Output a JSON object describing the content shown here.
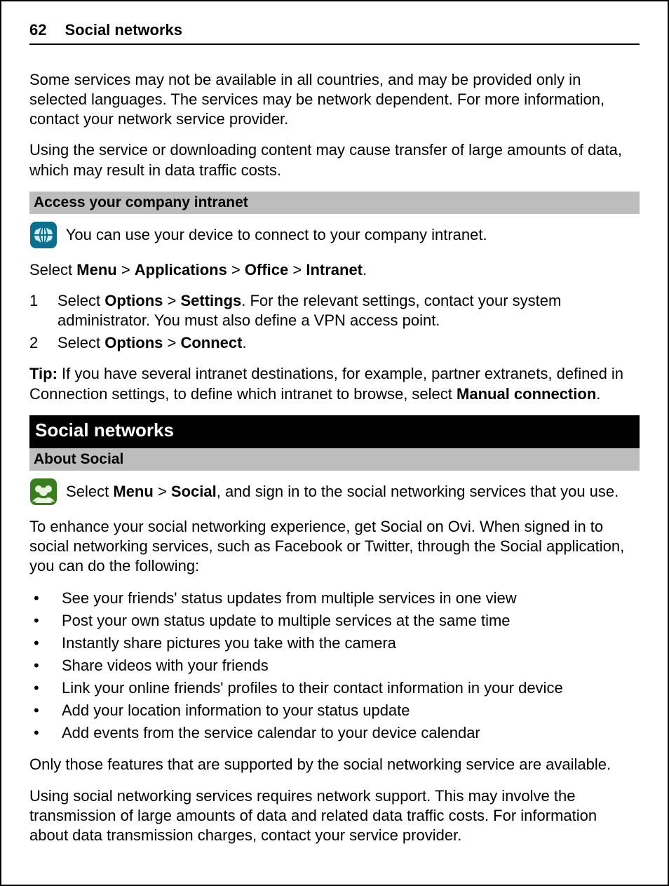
{
  "header": {
    "page_number": "62",
    "title": "Social networks"
  },
  "intro": {
    "p1": "Some services may not be available in all countries, and may be provided only in selected languages. The services may be network dependent. For more information, contact your network service provider.",
    "p2": "Using the service or downloading content may cause transfer of large amounts of data, which may result in data traffic costs."
  },
  "section1": {
    "title": "Access your company intranet",
    "icon_text": " You can use your device to connect to your company intranet.",
    "select_line": {
      "pre": "Select ",
      "b1": "Menu",
      "s1": " > ",
      "b2": "Applications",
      "s2": " > ",
      "b3": "Office",
      "s3": " > ",
      "b4": "Intranet",
      "post": "."
    },
    "steps": [
      {
        "pre": "Select ",
        "b1": "Options",
        "s1": " > ",
        "b2": "Settings",
        "post": ". For the relevant settings, contact your system administrator. You must also define a VPN access point."
      },
      {
        "pre": "Select ",
        "b1": "Options",
        "s1": " > ",
        "b2": "Connect",
        "post": "."
      }
    ],
    "tip": {
      "label": "Tip: ",
      "body_pre": "If you have several intranet destinations, for example, partner extranets, defined in Connection settings, to define which intranet to browse, select ",
      "bold": "Manual connection",
      "post": "."
    }
  },
  "chapter": {
    "title": "Social networks"
  },
  "section2": {
    "title": "About Social",
    "icon_line": {
      "pre": " Select ",
      "b1": "Menu",
      "s1": " > ",
      "b2": "Social",
      "post": ", and sign in to the social networking services that you use."
    },
    "p1": "To enhance your social networking experience, get Social on Ovi. When signed in to social networking services, such as Facebook or Twitter, through the Social application, you can do the following:",
    "bullets": [
      "See your friends' status updates from multiple services in one view",
      "Post your own status update to multiple services at the same time",
      "Instantly share pictures you take with the camera",
      "Share videos with your friends",
      "Link your online friends' profiles to their contact information in your device",
      "Add your location information to your status update",
      "Add events from the service calendar to your device calendar"
    ],
    "p2": "Only those features that are supported by the social networking service are available.",
    "p3": "Using social networking services requires network support. This may involve the transmission of large amounts of data and related data traffic costs. For information about data transmission charges, contact your service provider."
  }
}
